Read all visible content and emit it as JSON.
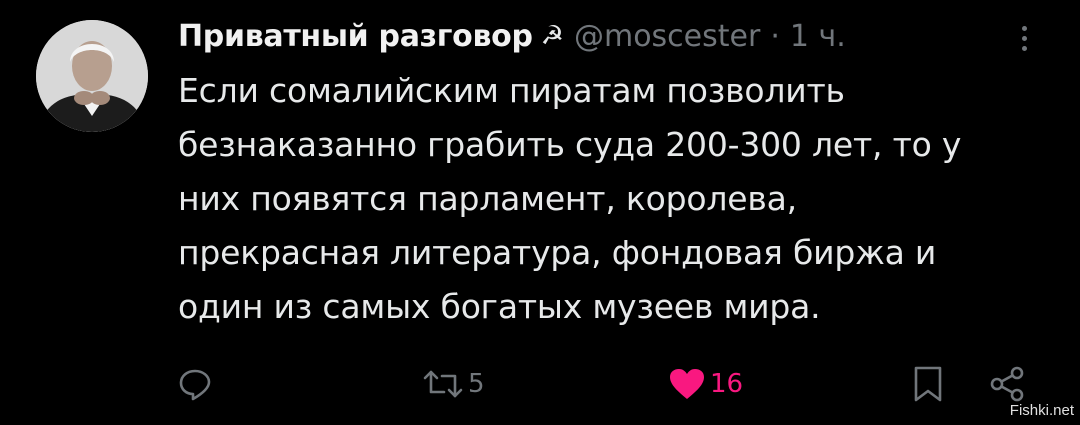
{
  "tweet": {
    "author_name": "Приватный разговор",
    "badge_symbol": "☭",
    "handle": "@moscester",
    "separator": "·",
    "time": "1 ч.",
    "text_lines": [
      "Если сомалийским пиратам позволить",
      "безнаказанно грабить суда 200-300 лет, то у",
      "них появятся парламент, королева,",
      "прекрасная литература, фондовая биржа и",
      "один из самых богатых музеев мира."
    ]
  },
  "actions": {
    "reply_icon": "reply-icon",
    "retweet_icon": "retweet-icon",
    "retweet_count": "5",
    "like_icon": "heart-icon",
    "like_count": "16",
    "bookmark_icon": "bookmark-icon",
    "share_icon": "share-icon"
  },
  "colors": {
    "background": "#000000",
    "text": "#e7e9ea",
    "secondary": "#71767b",
    "like": "#f91880"
  },
  "watermark": "Fishki.net"
}
